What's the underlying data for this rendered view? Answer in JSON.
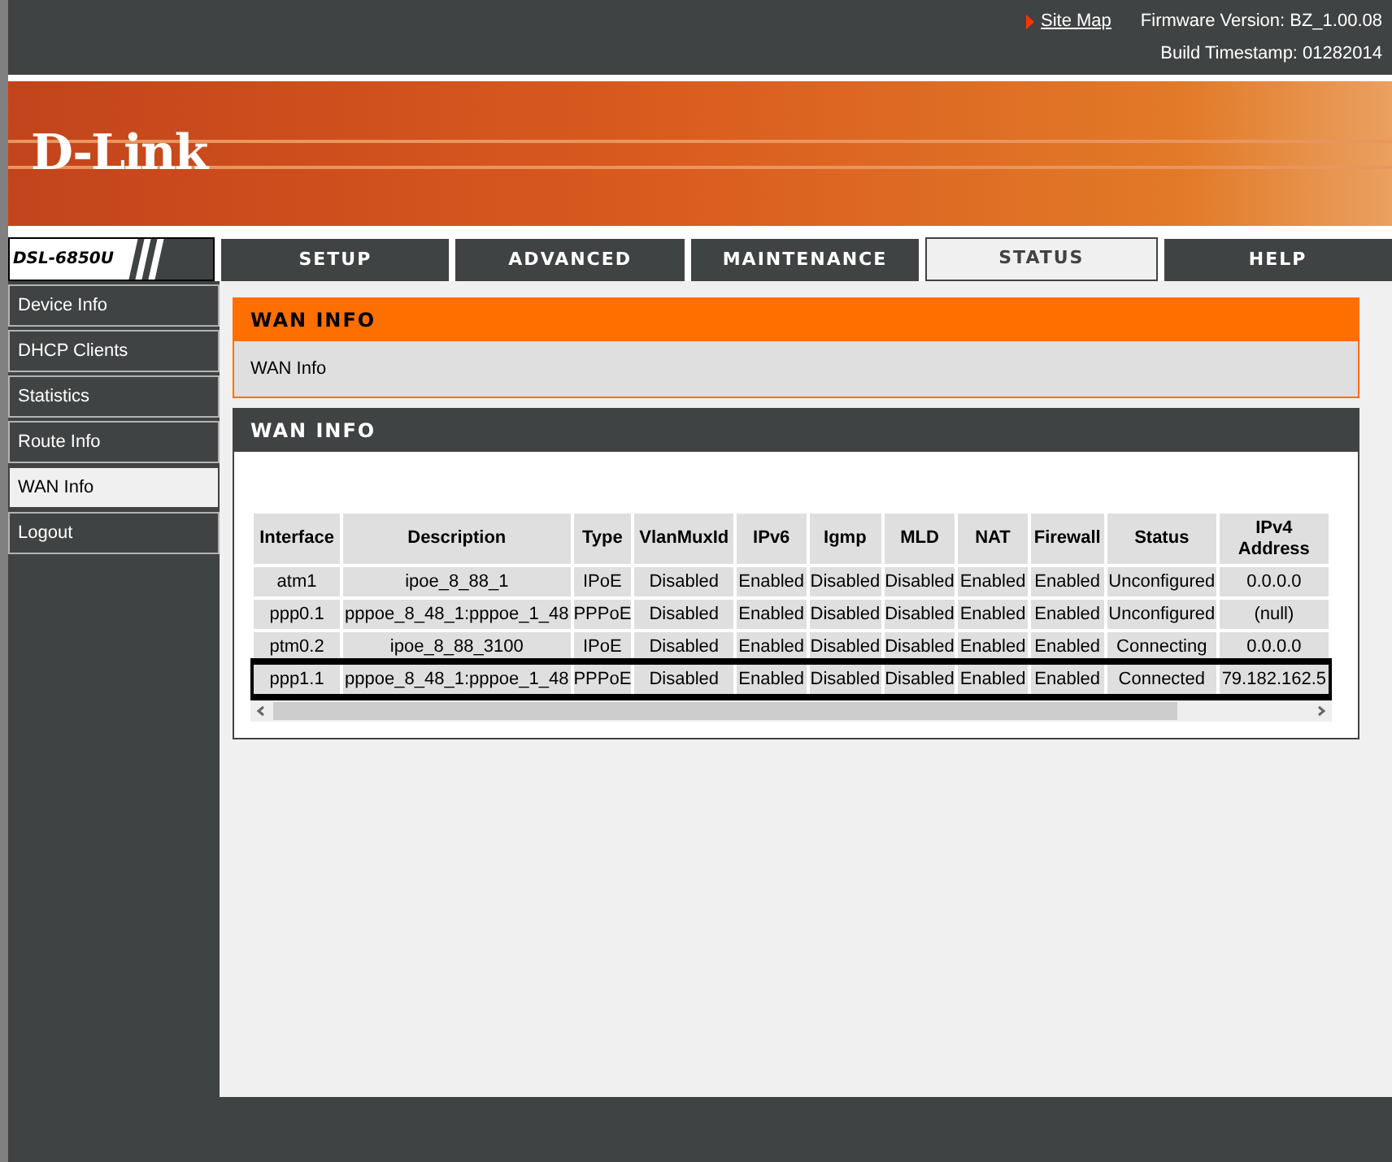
{
  "header": {
    "site_map": "Site Map",
    "firmware": "Firmware Version: BZ_1.00.08",
    "timestamp": "Build Timestamp: 01282014"
  },
  "logo": "D-Link",
  "model": "DSL-6850U",
  "tabs": [
    {
      "label": "SETUP",
      "selected": false
    },
    {
      "label": "ADVANCED",
      "selected": false
    },
    {
      "label": "MAINTENANCE",
      "selected": false
    },
    {
      "label": "STATUS",
      "selected": true
    },
    {
      "label": "HELP",
      "selected": false
    }
  ],
  "sidebar": {
    "items": [
      {
        "label": "Device Info",
        "selected": false
      },
      {
        "label": "DHCP Clients",
        "selected": false
      },
      {
        "label": "Statistics",
        "selected": false
      },
      {
        "label": "Route Info",
        "selected": false
      },
      {
        "label": "WAN Info",
        "selected": true
      },
      {
        "label": "Logout",
        "selected": false
      }
    ]
  },
  "intro": {
    "title": "WAN INFO",
    "text": "WAN Info"
  },
  "panel": {
    "title": "WAN INFO",
    "table": {
      "columns": [
        "Interface",
        "Description",
        "Type",
        "VlanMuxId",
        "IPv6",
        "Igmp",
        "MLD",
        "NAT",
        "Firewall",
        "Status",
        "IPv4 Address"
      ],
      "rows": [
        {
          "cells": [
            "atm1",
            "ipoe_8_88_1",
            "IPoE",
            "Disabled",
            "Enabled",
            "Disabled",
            "Disabled",
            "Enabled",
            "Enabled",
            "Unconfigured",
            "0.0.0.0"
          ],
          "highlighted": false
        },
        {
          "cells": [
            "ppp0.1",
            "pppoe_8_48_1:pppoe_1_48",
            "PPPoE",
            "Disabled",
            "Enabled",
            "Disabled",
            "Disabled",
            "Enabled",
            "Enabled",
            "Unconfigured",
            "(null)"
          ],
          "highlighted": false
        },
        {
          "cells": [
            "ptm0.2",
            "ipoe_8_88_3100",
            "IPoE",
            "Disabled",
            "Enabled",
            "Disabled",
            "Disabled",
            "Enabled",
            "Enabled",
            "Connecting",
            "0.0.0.0"
          ],
          "highlighted": false
        },
        {
          "cells": [
            "ppp1.1",
            "pppoe_8_48_1:pppoe_1_48",
            "PPPoE",
            "Disabled",
            "Enabled",
            "Disabled",
            "Disabled",
            "Enabled",
            "Enabled",
            "Connected",
            "79.182.162.5"
          ],
          "highlighted": true
        }
      ]
    }
  }
}
